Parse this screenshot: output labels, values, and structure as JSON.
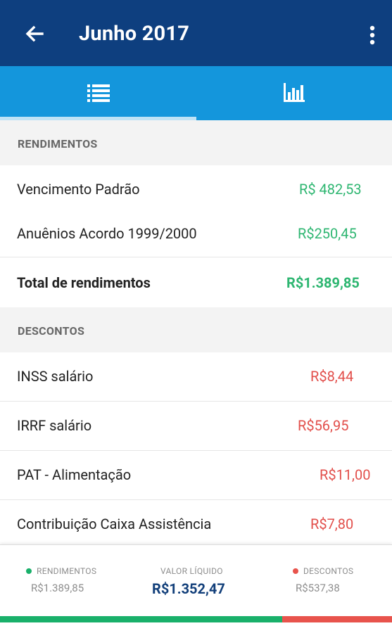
{
  "header": {
    "title": "Junho 2017",
    "back_icon": "arrow-left-icon",
    "more_icon": "more-vert-icon"
  },
  "tabs": [
    {
      "name": "list",
      "icon": "list-icon",
      "selected": true
    },
    {
      "name": "chart",
      "icon": "bar-chart-icon",
      "selected": false
    }
  ],
  "rendimentos": {
    "header": "RENDIMENTOS",
    "items": [
      {
        "label": "Vencimento Padrão",
        "value": "R$ 482,53"
      },
      {
        "label": "Anuênios Acordo 1999/2000",
        "value": "R$250,45"
      }
    ],
    "total": {
      "label": "Total de rendimentos",
      "value": "R$1.389,85"
    }
  },
  "descontos": {
    "header": "DESCONTOS",
    "items": [
      {
        "label": "INSS salário",
        "value": "R$8,44"
      },
      {
        "label": "IRRF salário",
        "value": "R$56,95"
      },
      {
        "label": "PAT - Alimentação",
        "value": "R$11,00"
      },
      {
        "label": "Contribuição Caixa Assistência",
        "value": "R$7,80"
      }
    ]
  },
  "footer": {
    "rendimentos_label": "RENDIMENTOS",
    "rendimentos_value": "R$1.389,85",
    "liquido_label": "VALOR LÍQUIDO",
    "liquido_value": "R$1.352,47",
    "descontos_label": "DESCONTOS",
    "descontos_value": "R$537,38",
    "green_fraction": 0.72
  },
  "colors": {
    "primary": "#0e3f7f",
    "tab_bar": "#1496dc",
    "income": "#2eb671",
    "deduction": "#e24f4b"
  }
}
